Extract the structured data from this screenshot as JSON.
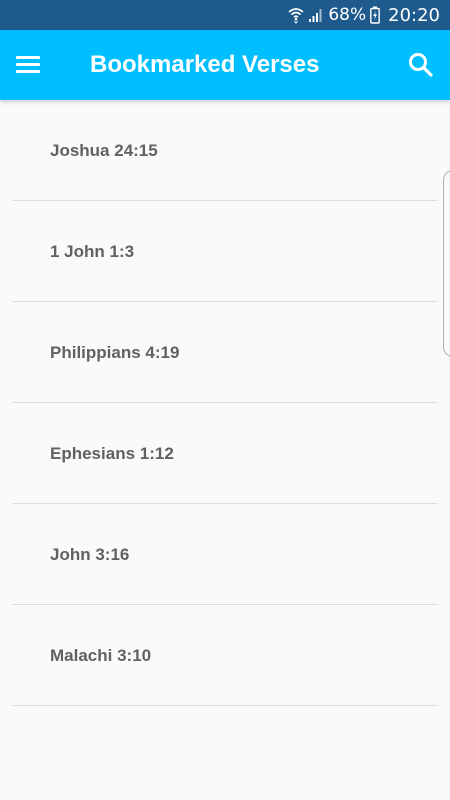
{
  "status_bar": {
    "battery_percent": "68%",
    "time": "20:20",
    "icons": [
      "wifi-icon",
      "signal-icon",
      "battery-charging-icon"
    ]
  },
  "app_bar": {
    "title": "Bookmarked Verses",
    "menu_icon": "hamburger-menu-icon",
    "search_icon": "search-icon",
    "background_color": "#00bfff"
  },
  "bookmarks": [
    {
      "label": "Joshua 24:15"
    },
    {
      "label": "1 John 1:3"
    },
    {
      "label": "Philippians 4:19"
    },
    {
      "label": "Ephesians 1:12"
    },
    {
      "label": "John 3:16"
    },
    {
      "label": "Malachi 3:10"
    }
  ]
}
